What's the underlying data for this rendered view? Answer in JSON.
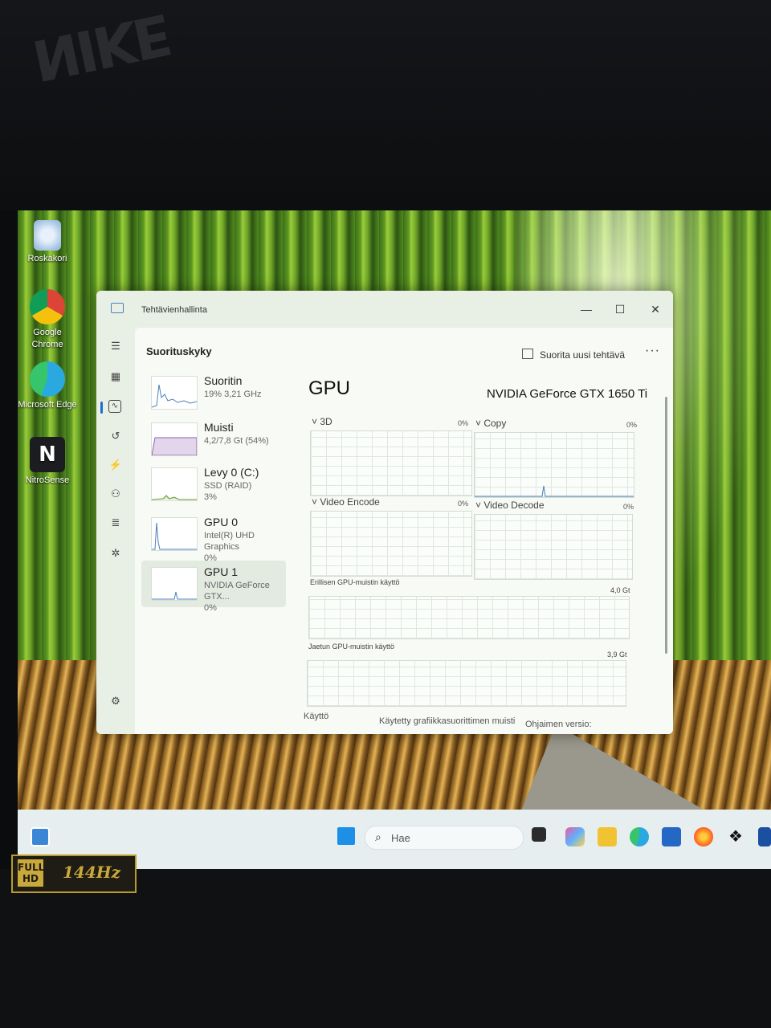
{
  "desktop": {
    "icons": [
      {
        "label": "Roskakori"
      },
      {
        "label": "Google Chrome"
      },
      {
        "label": "Microsoft Edge"
      },
      {
        "label": "NitroSense"
      }
    ]
  },
  "window": {
    "title": "Tehtävienhallinta",
    "minimize": "—",
    "maximize": "☐",
    "close": "✕"
  },
  "header": {
    "page_title": "Suorituskyky",
    "run_task_label": "Suorita uusi tehtävä",
    "more": "···"
  },
  "sidebar": {
    "items": [
      {
        "name": "Suoritin",
        "line1": "19% 3,21 GHz",
        "line2": ""
      },
      {
        "name": "Muisti",
        "line1": "4,2/7,8 Gt (54%)",
        "line2": ""
      },
      {
        "name": "Levy 0 (C:)",
        "line1": "SSD (RAID)",
        "line2": "3%"
      },
      {
        "name": "GPU 0",
        "line1": "Intel(R) UHD Graphics",
        "line2": "0%"
      },
      {
        "name": "GPU 1",
        "line1": "NVIDIA GeForce GTX...",
        "line2": "0%"
      }
    ]
  },
  "gpu": {
    "heading": "GPU",
    "model": "NVIDIA GeForce GTX 1650 Ti",
    "engines": [
      {
        "label": "3D",
        "value": "0%"
      },
      {
        "label": "Copy",
        "value": "0%"
      },
      {
        "label": "Video Encode",
        "value": "0%"
      },
      {
        "label": "Video Decode",
        "value": "0%"
      }
    ],
    "dedicated_label": "Erillisen GPU-muistin käyttö",
    "dedicated_max": "4,0 Gt",
    "shared_label": "Jaetun GPU-muistin käyttö",
    "shared_max": "3,9 Gt",
    "footer": {
      "usage": "Käyttö",
      "mem_used": "Käytetty grafiikkasuorittimen muisti",
      "driver": "Ohjaimen versio:"
    }
  },
  "taskbar": {
    "search_placeholder": "Hae"
  },
  "badge": {
    "fhd": "FULL HD",
    "hz": "144Hz"
  },
  "colors": {
    "accent": "#1f6fd1",
    "graph_line": "#4a7fb8"
  }
}
